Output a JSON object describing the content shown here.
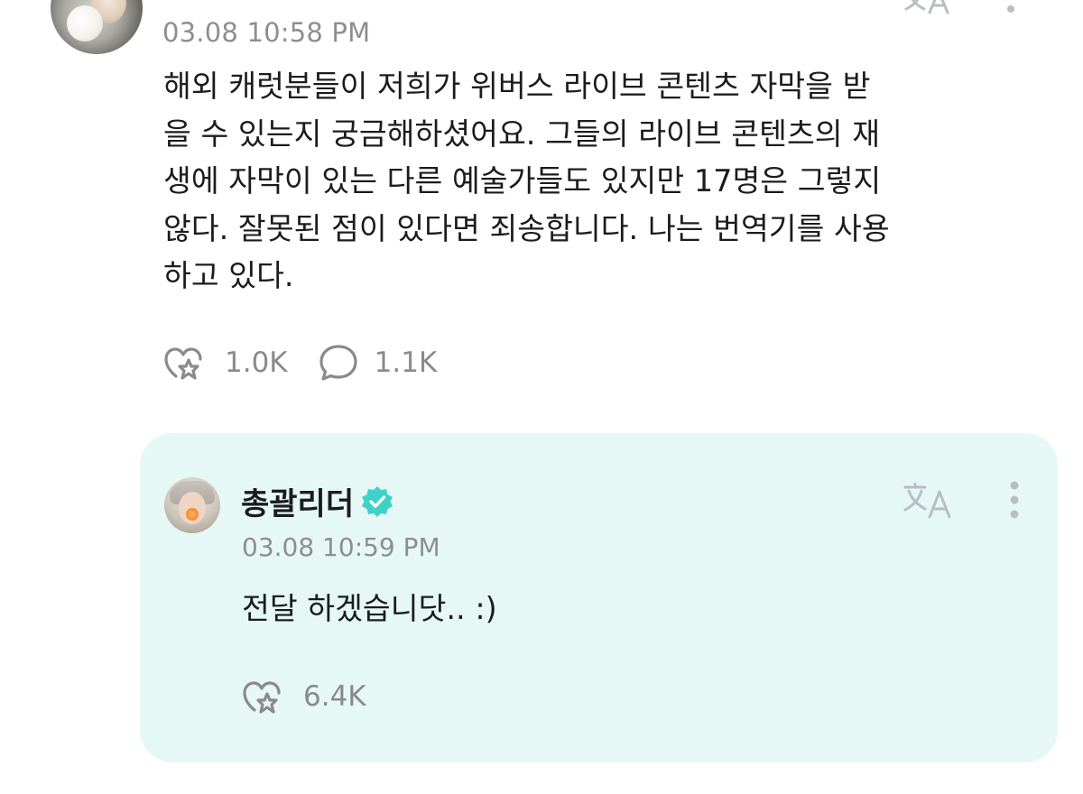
{
  "post": {
    "timestamp": "03.08 10:58 PM",
    "body_lines": [
      "해외 캐럿분들이 저희가 위버스 라이브 콘텐츠 자막을 받",
      "을 수 있는지 궁금해하셨어요. 그들의 라이브 콘텐츠의 재",
      "생에 자막이 있는 다른 예술가들도 있지만 17명은 그렇지",
      "않다. 잘못된 점이 있다면 죄송합니다. 나는 번역기를 사용",
      "하고 있다."
    ],
    "like_count": "1.0K",
    "comment_count": "1.1K",
    "icons": {
      "like": "heart-sparkle-icon",
      "comment": "speech-bubble-icon",
      "translate": "translate-icon",
      "more": "more-vertical-icon"
    }
  },
  "reply": {
    "username": "총괄리더",
    "verified": true,
    "timestamp": "03.08 10:59 PM",
    "body": "전달 하겠습니닷.. :)",
    "like_count": "6.4K",
    "colors": {
      "card_background": "#e6f8f5",
      "verified_badge": "#3fd1c9"
    }
  }
}
